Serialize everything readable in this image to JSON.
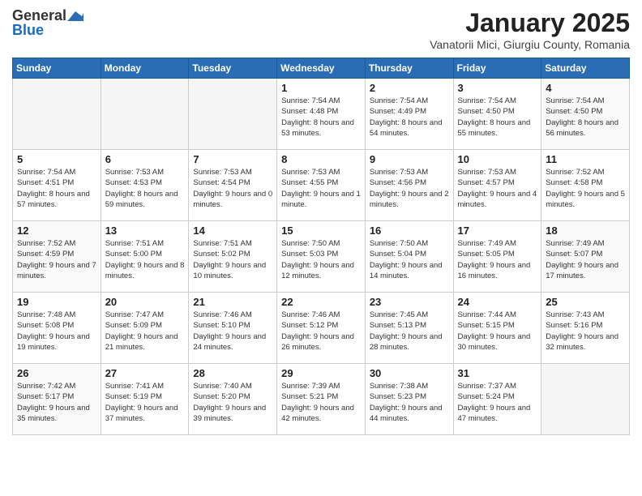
{
  "header": {
    "logo_general": "General",
    "logo_blue": "Blue",
    "calendar_title": "January 2025",
    "calendar_subtitle": "Vanatorii Mici, Giurgiu County, Romania"
  },
  "weekdays": [
    "Sunday",
    "Monday",
    "Tuesday",
    "Wednesday",
    "Thursday",
    "Friday",
    "Saturday"
  ],
  "weeks": [
    [
      {
        "day": "",
        "empty": true
      },
      {
        "day": "",
        "empty": true
      },
      {
        "day": "",
        "empty": true
      },
      {
        "day": "1",
        "sunrise": "7:54 AM",
        "sunset": "4:48 PM",
        "daylight": "8 hours and 53 minutes."
      },
      {
        "day": "2",
        "sunrise": "7:54 AM",
        "sunset": "4:49 PM",
        "daylight": "8 hours and 54 minutes."
      },
      {
        "day": "3",
        "sunrise": "7:54 AM",
        "sunset": "4:50 PM",
        "daylight": "8 hours and 55 minutes."
      },
      {
        "day": "4",
        "sunrise": "7:54 AM",
        "sunset": "4:50 PM",
        "daylight": "8 hours and 56 minutes."
      }
    ],
    [
      {
        "day": "5",
        "sunrise": "7:54 AM",
        "sunset": "4:51 PM",
        "daylight": "8 hours and 57 minutes."
      },
      {
        "day": "6",
        "sunrise": "7:53 AM",
        "sunset": "4:53 PM",
        "daylight": "8 hours and 59 minutes."
      },
      {
        "day": "7",
        "sunrise": "7:53 AM",
        "sunset": "4:54 PM",
        "daylight": "9 hours and 0 minutes."
      },
      {
        "day": "8",
        "sunrise": "7:53 AM",
        "sunset": "4:55 PM",
        "daylight": "9 hours and 1 minute."
      },
      {
        "day": "9",
        "sunrise": "7:53 AM",
        "sunset": "4:56 PM",
        "daylight": "9 hours and 2 minutes."
      },
      {
        "day": "10",
        "sunrise": "7:53 AM",
        "sunset": "4:57 PM",
        "daylight": "9 hours and 4 minutes."
      },
      {
        "day": "11",
        "sunrise": "7:52 AM",
        "sunset": "4:58 PM",
        "daylight": "9 hours and 5 minutes."
      }
    ],
    [
      {
        "day": "12",
        "sunrise": "7:52 AM",
        "sunset": "4:59 PM",
        "daylight": "9 hours and 7 minutes."
      },
      {
        "day": "13",
        "sunrise": "7:51 AM",
        "sunset": "5:00 PM",
        "daylight": "9 hours and 8 minutes."
      },
      {
        "day": "14",
        "sunrise": "7:51 AM",
        "sunset": "5:02 PM",
        "daylight": "9 hours and 10 minutes."
      },
      {
        "day": "15",
        "sunrise": "7:50 AM",
        "sunset": "5:03 PM",
        "daylight": "9 hours and 12 minutes."
      },
      {
        "day": "16",
        "sunrise": "7:50 AM",
        "sunset": "5:04 PM",
        "daylight": "9 hours and 14 minutes."
      },
      {
        "day": "17",
        "sunrise": "7:49 AM",
        "sunset": "5:05 PM",
        "daylight": "9 hours and 16 minutes."
      },
      {
        "day": "18",
        "sunrise": "7:49 AM",
        "sunset": "5:07 PM",
        "daylight": "9 hours and 17 minutes."
      }
    ],
    [
      {
        "day": "19",
        "sunrise": "7:48 AM",
        "sunset": "5:08 PM",
        "daylight": "9 hours and 19 minutes."
      },
      {
        "day": "20",
        "sunrise": "7:47 AM",
        "sunset": "5:09 PM",
        "daylight": "9 hours and 21 minutes."
      },
      {
        "day": "21",
        "sunrise": "7:46 AM",
        "sunset": "5:10 PM",
        "daylight": "9 hours and 24 minutes."
      },
      {
        "day": "22",
        "sunrise": "7:46 AM",
        "sunset": "5:12 PM",
        "daylight": "9 hours and 26 minutes."
      },
      {
        "day": "23",
        "sunrise": "7:45 AM",
        "sunset": "5:13 PM",
        "daylight": "9 hours and 28 minutes."
      },
      {
        "day": "24",
        "sunrise": "7:44 AM",
        "sunset": "5:15 PM",
        "daylight": "9 hours and 30 minutes."
      },
      {
        "day": "25",
        "sunrise": "7:43 AM",
        "sunset": "5:16 PM",
        "daylight": "9 hours and 32 minutes."
      }
    ],
    [
      {
        "day": "26",
        "sunrise": "7:42 AM",
        "sunset": "5:17 PM",
        "daylight": "9 hours and 35 minutes."
      },
      {
        "day": "27",
        "sunrise": "7:41 AM",
        "sunset": "5:19 PM",
        "daylight": "9 hours and 37 minutes."
      },
      {
        "day": "28",
        "sunrise": "7:40 AM",
        "sunset": "5:20 PM",
        "daylight": "9 hours and 39 minutes."
      },
      {
        "day": "29",
        "sunrise": "7:39 AM",
        "sunset": "5:21 PM",
        "daylight": "9 hours and 42 minutes."
      },
      {
        "day": "30",
        "sunrise": "7:38 AM",
        "sunset": "5:23 PM",
        "daylight": "9 hours and 44 minutes."
      },
      {
        "day": "31",
        "sunrise": "7:37 AM",
        "sunset": "5:24 PM",
        "daylight": "9 hours and 47 minutes."
      },
      {
        "day": "",
        "empty": true
      }
    ]
  ]
}
